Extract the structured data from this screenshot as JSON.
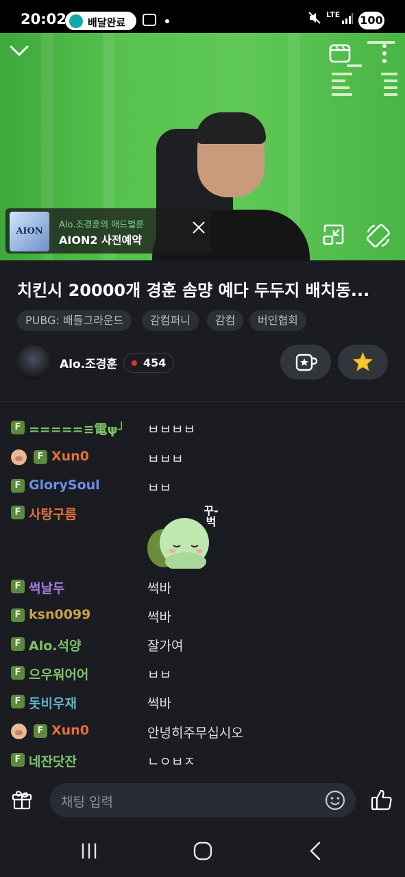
{
  "status_bar": {
    "time": "20:02",
    "notification_pill": "배달완료",
    "network": "LTE",
    "battery": "100"
  },
  "player": {
    "ad": {
      "subtitle": "Alo.조경훈의 애드벌룬",
      "title": "AION2 사전예약",
      "logo_text": "AION"
    }
  },
  "stream": {
    "title": "치킨시 20000개 경훈 솜먕 예다 두두지 배치동...",
    "tags": [
      "PUBG: 배틀그라운드",
      "감컴퍼니",
      "감컴",
      "버인협회"
    ],
    "streamer": "Alo.조경훈",
    "viewers": "454"
  },
  "chat": {
    "messages": [
      {
        "badge": "F",
        "pig": false,
        "nick": "=====≡電ψ┘",
        "color": "#7ec46a",
        "text": "ㅂㅂㅂㅂ"
      },
      {
        "badge": "F",
        "pig": true,
        "nick": "Xun0",
        "color": "#e0703f",
        "text": "ㅂㅂㅂ"
      },
      {
        "badge": "F",
        "pig": false,
        "nick": "GlorySoul",
        "color": "#6c8ee8",
        "text": "ㅂㅂ"
      },
      {
        "badge": "F",
        "pig": false,
        "nick": "사탕구름",
        "color": "#e0703f",
        "text": ""
      },
      {
        "badge": "F",
        "pig": false,
        "nick": "썩날두",
        "color": "#a47be0",
        "text": "썩바"
      },
      {
        "badge": "F",
        "pig": false,
        "nick": "ksn0099",
        "color": "#c8a24a",
        "text": "썩바"
      },
      {
        "badge": "F",
        "pig": false,
        "nick": "Alo.석양",
        "color": "#7ec46a",
        "text": "잘가여"
      },
      {
        "badge": "F",
        "pig": false,
        "nick": "으우워어어",
        "color": "#7ec46a",
        "text": "ㅂㅂ"
      },
      {
        "badge": "F",
        "pig": false,
        "nick": "돗비우재",
        "color": "#5fb3c9",
        "text": "썩바"
      },
      {
        "badge": "F",
        "pig": true,
        "nick": "Xun0",
        "color": "#e0703f",
        "text": "안녕히주무십시오"
      },
      {
        "badge": "F",
        "pig": false,
        "nick": "네잔닷잔",
        "color": "#7ec46a",
        "text": "ㄴㅇㅂㅈ"
      }
    ],
    "sticker_text": "꾸-벅",
    "input_placeholder": "채팅 입력"
  },
  "colors": {
    "background": "#1b1c21",
    "chroma_green": "#57c24e",
    "live_red": "#e5322e"
  }
}
